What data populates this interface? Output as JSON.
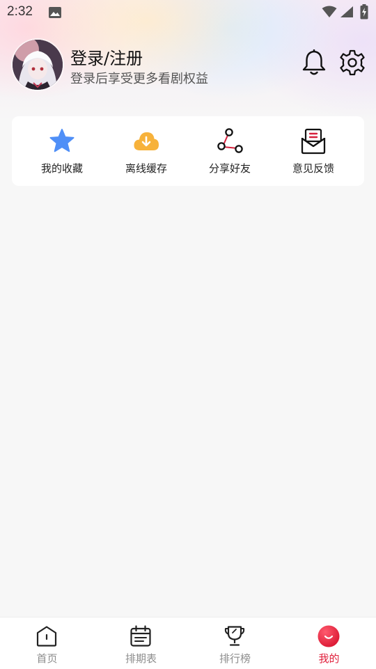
{
  "status_bar": {
    "time": "2:32"
  },
  "profile": {
    "title": "登录/注册",
    "subtitle": "登录后享受更多看剧权益"
  },
  "quick_actions": [
    {
      "label": "我的收藏",
      "icon": "star-icon",
      "color": "#4f8ff7"
    },
    {
      "label": "离线缓存",
      "icon": "cloud-download-icon",
      "color": "#f7b23b"
    },
    {
      "label": "分享好友",
      "icon": "share-icon",
      "color": "#d6213d"
    },
    {
      "label": "意见反馈",
      "icon": "feedback-mail-icon",
      "color": "#d6213d"
    }
  ],
  "bottom_nav": {
    "items": [
      {
        "label": "首页",
        "icon": "home-icon",
        "active": false
      },
      {
        "label": "排期表",
        "icon": "calendar-icon",
        "active": false
      },
      {
        "label": "排行榜",
        "icon": "trophy-icon",
        "active": false
      },
      {
        "label": "我的",
        "icon": "profile-smile-icon",
        "active": true
      }
    ]
  },
  "colors": {
    "accent": "#e0203c",
    "inactive": "#8d8d8d",
    "background": "#f7f7f7"
  }
}
